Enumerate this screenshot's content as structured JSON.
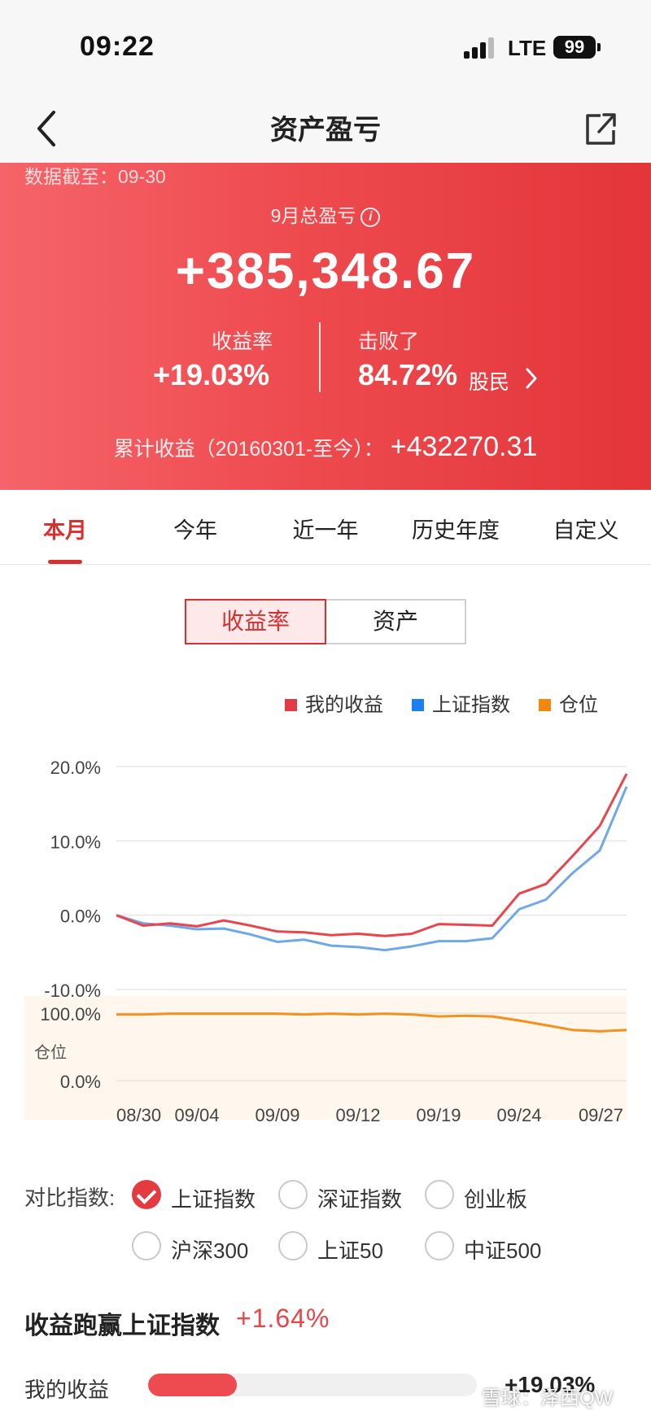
{
  "status_bar": {
    "time": "09:22",
    "network": "LTE",
    "battery": "99"
  },
  "nav": {
    "title": "资产盈亏",
    "back_icon": "chevron-left-icon",
    "share_icon": "share-icon"
  },
  "hero": {
    "data_date_label": "数据截至：",
    "data_date": "09-30",
    "total_label": "9月总盈亏",
    "info_icon": "i",
    "total_amount": "+385,348.67",
    "yield_label": "收益率",
    "yield_value": "+19.03%",
    "beat_label": "击败了",
    "beat_value": "84.72%",
    "beat_suffix": "股民",
    "cumulative_label": "累计收益（20160301-至今）：",
    "cumulative_value": "+432270.31"
  },
  "tabs": [
    {
      "label": "本月",
      "active": true
    },
    {
      "label": "今年",
      "active": false
    },
    {
      "label": "近一年",
      "active": false
    },
    {
      "label": "历史年度",
      "active": false
    },
    {
      "label": "自定义",
      "active": false
    }
  ],
  "segment": {
    "left": "收益率",
    "right": "资产",
    "selected": "收益率"
  },
  "colors": {
    "my_return": "#e8454c",
    "sh_index": "#6fa8e8",
    "position": "#f39020",
    "accent": "#d9302f"
  },
  "chart_data": {
    "type": "line",
    "legend": [
      "我的收益",
      "上证指数",
      "仓位"
    ],
    "legend_placement": "top-right",
    "x_ticks": [
      "08/30",
      "09/04",
      "09/09",
      "09/12",
      "09/19",
      "09/24",
      "09/27"
    ],
    "x_tick_index": [
      0,
      3,
      6,
      9,
      12,
      15,
      18
    ],
    "upper": {
      "y_ticks": [
        "20.0%",
        "10.0%",
        "0.0%",
        "-10.0%"
      ],
      "y_tick_values": [
        20,
        10,
        0,
        -10
      ],
      "ylim": [
        -10,
        20
      ],
      "grid": true,
      "series": [
        {
          "name": "我的收益",
          "color": "#e8454c",
          "values": [
            0,
            -1.4,
            -1.1,
            -1.5,
            -0.7,
            -1.4,
            -2.2,
            -2.3,
            -2.7,
            -2.5,
            -2.8,
            -2.5,
            -1.2,
            -1.3,
            -1.4,
            2.9,
            4.2,
            8.0,
            12.0,
            19.03
          ]
        },
        {
          "name": "上证指数",
          "color": "#6fa8e8",
          "values": [
            0,
            -1.1,
            -1.4,
            -1.9,
            -1.8,
            -2.6,
            -3.6,
            -3.3,
            -4.1,
            -4.3,
            -4.7,
            -4.2,
            -3.5,
            -3.5,
            -3.1,
            0.8,
            2.1,
            5.7,
            8.7,
            17.3
          ]
        }
      ]
    },
    "lower": {
      "label": "仓位",
      "y_ticks": [
        "100.0%",
        "0.0%"
      ],
      "y_tick_values": [
        100,
        0
      ],
      "ylim": [
        0,
        100
      ],
      "series": [
        {
          "name": "仓位",
          "color": "#f39020",
          "values": [
            98,
            98,
            99,
            99,
            99,
            99,
            99,
            98,
            99,
            98,
            99,
            98,
            95,
            96,
            95,
            89,
            82,
            75,
            73,
            75
          ]
        }
      ]
    }
  },
  "compare": {
    "label": "对比指数:",
    "options": [
      {
        "label": "上证指数",
        "checked": true
      },
      {
        "label": "深证指数",
        "checked": false
      },
      {
        "label": "创业板",
        "checked": false
      },
      {
        "label": "沪深300",
        "checked": false
      },
      {
        "label": "上证50",
        "checked": false
      },
      {
        "label": "中证500",
        "checked": false
      }
    ]
  },
  "beat_section": {
    "title": "收益跑赢上证指数",
    "diff": "+1.64%",
    "bar_label": "我的收益",
    "bar_value": "+19.03%",
    "bar_fraction": 0.27
  },
  "watermark": "雪球：泽西QW"
}
